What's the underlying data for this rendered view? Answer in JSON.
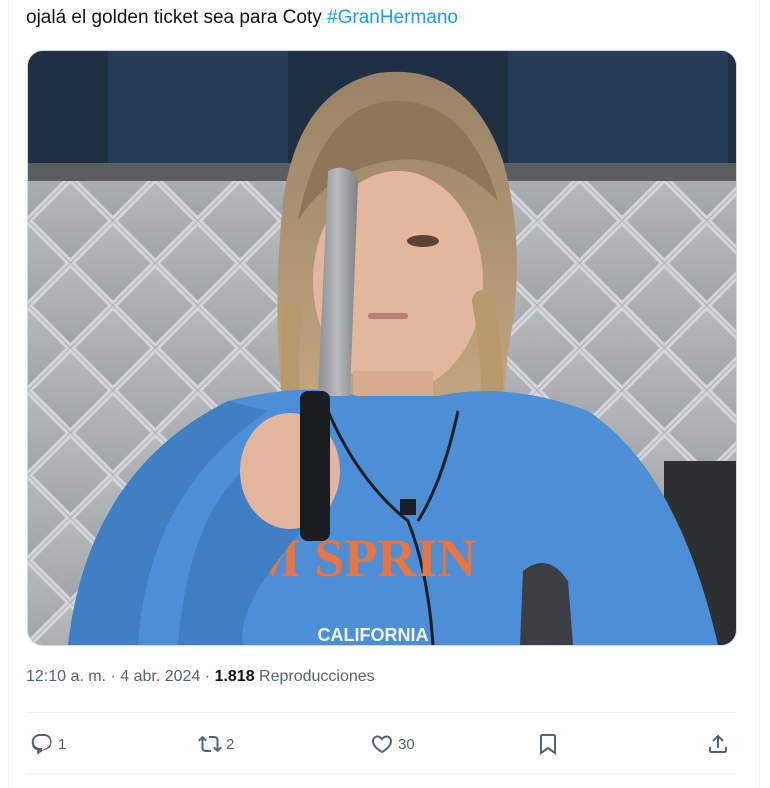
{
  "tweet": {
    "text": "ojalá el golden ticket sea para Coty ",
    "hashtag": "#GranHermano"
  },
  "media": {
    "shirt_text": "M SPRIN",
    "shirt_subtext": "CALIFORNIA"
  },
  "meta": {
    "time": "12:10 a. m.",
    "separator": " · ",
    "date": "4 abr. 2024",
    "views_count": "1.818",
    "views_label": " Reproducciones"
  },
  "actions": {
    "reply_count": "1",
    "retweet_count": "2",
    "like_count": "30",
    "bookmark_count": "",
    "share_count": ""
  },
  "colors": {
    "accent": "#1d9bf0",
    "text": "#0f1419",
    "muted": "#536471"
  }
}
